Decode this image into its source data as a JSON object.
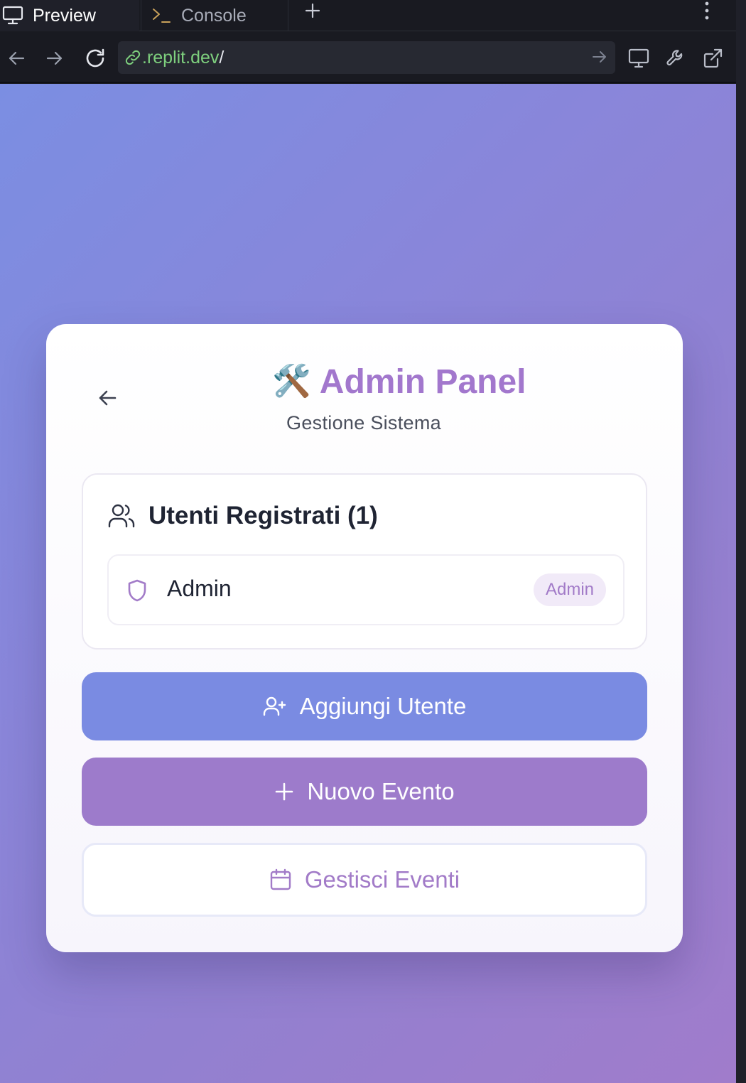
{
  "browser": {
    "tabs": [
      {
        "label": "Preview",
        "icon": "monitor-icon",
        "active": true
      },
      {
        "label": "Console",
        "icon": "terminal-icon",
        "active": false
      }
    ],
    "url": {
      "highlight": ".replit.dev",
      "rest": "/"
    }
  },
  "panel": {
    "title_emoji": "🛠️",
    "title": "Admin Panel",
    "subtitle": "Gestione Sistema"
  },
  "users": {
    "heading": "Utenti Registrati (1)",
    "list": [
      {
        "name": "Admin",
        "role": "Admin",
        "icon": "shield-icon"
      }
    ]
  },
  "actions": {
    "add_user": "Aggiungi Utente",
    "new_event": "Nuovo Evento",
    "manage_events": "Gestisci Eventi"
  },
  "colors": {
    "accent_purple": "#a277cd",
    "button_blue": "#7a8be2",
    "button_purple": "#9d7bcb",
    "url_green": "#7ed07e"
  }
}
